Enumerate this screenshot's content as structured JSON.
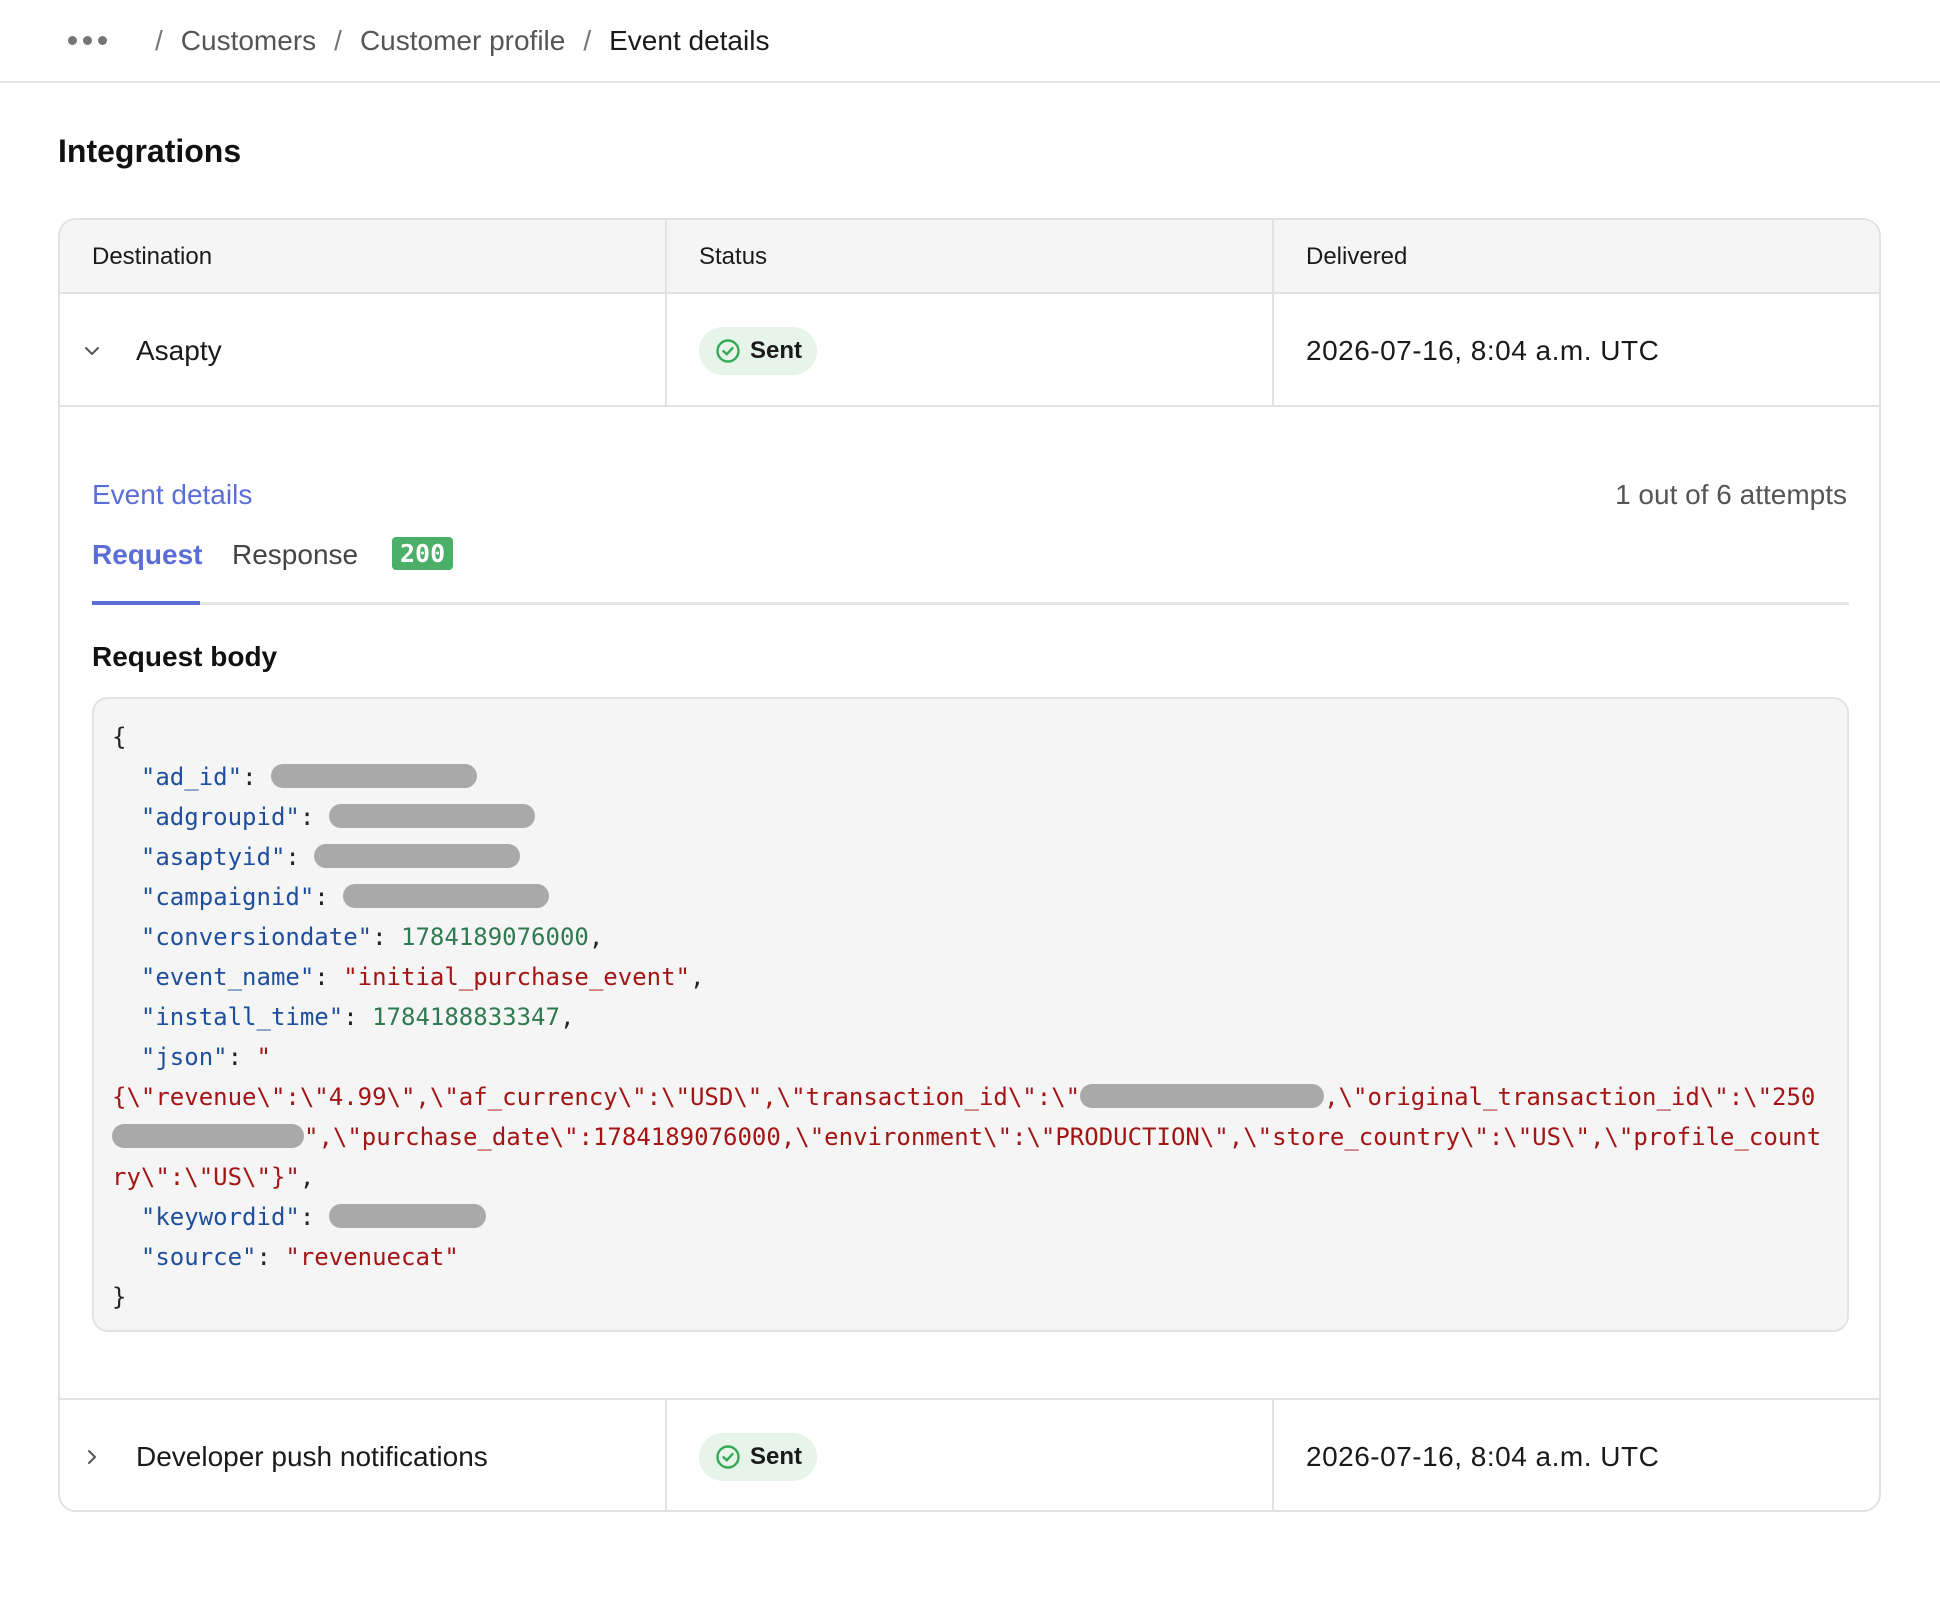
{
  "breadcrumb": {
    "items": [
      "Customers",
      "Customer profile",
      "Event details"
    ],
    "separator": "/"
  },
  "page": {
    "title": "Integrations"
  },
  "table": {
    "headers": [
      "Destination",
      "Status",
      "Delivered"
    ],
    "rows": [
      {
        "destination": "Asapty",
        "status": "Sent",
        "delivered": "2026-07-16, 8:04 a.m. UTC",
        "expanded": true
      },
      {
        "destination": "Developer push notifications",
        "status": "Sent",
        "delivered": "2026-07-16, 8:04 a.m. UTC",
        "expanded": false
      }
    ]
  },
  "details": {
    "link_label": "Event details",
    "attempts": "1 out of 6 attempts",
    "tabs": {
      "request": "Request",
      "response": "Response",
      "status_code": "200"
    },
    "body_label": "Request body",
    "code": {
      "open": "{",
      "close": "}",
      "k_ad_id": "\"ad_id\"",
      "k_adgroupid": "\"adgroupid\"",
      "k_asaptyid": "\"asaptyid\"",
      "k_campaignid": "\"campaignid\"",
      "k_conversiondate": "\"conversiondate\"",
      "v_conversiondate": "1784189076000",
      "k_event_name": "\"event_name\"",
      "v_event_name": "\"initial_purchase_event\"",
      "k_install_time": "\"install_time\"",
      "v_install_time": "1784188833347",
      "k_json": "\"json\"",
      "v_json_open": "\"",
      "v_json_line1a": "{\\\"revenue\\\":\\\"4.99\\\",\\\"af_currency\\\":\\\"USD\\\",\\\"transaction_id\\\":\\\"",
      "v_json_line1b": ",\\\"original_transaction_id\\\":\\\"250",
      "v_json_line2": "\",\\\"purchase_date\\\":1784189076000,\\\"environment\\\":\\\"PRODUCTION\\\",\\\"store_country\\\":\\\"US\\\",\\\"profile_count",
      "v_json_line3": "ry\\\":\\\"US\\\"}\"",
      "k_keywordid": "\"keywordid\"",
      "k_source": "\"source\"",
      "v_source": "\"revenuecat\""
    }
  },
  "colors": {
    "accent": "#5b6ed6",
    "success_bg": "#e6f4ea",
    "success_icon": "#34a853",
    "code_status": "#4caf68"
  }
}
